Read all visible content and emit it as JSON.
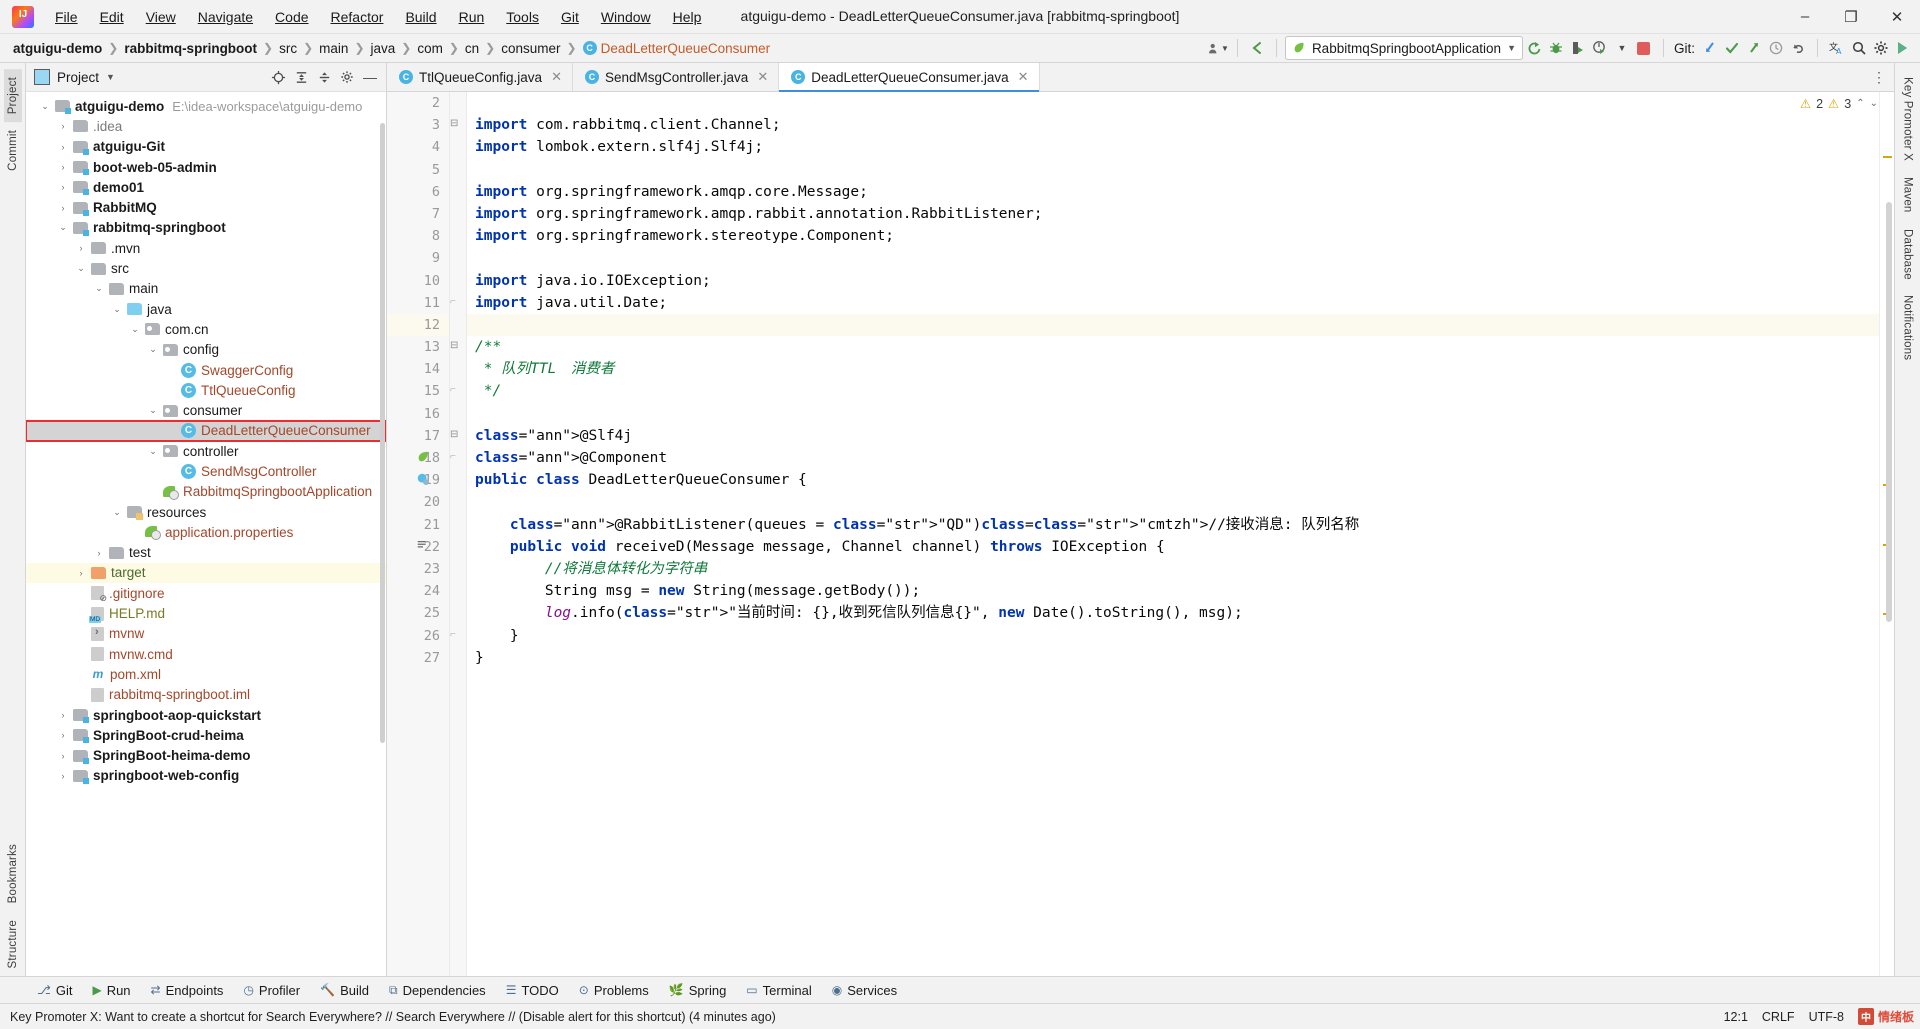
{
  "window": {
    "title": "atguigu-demo - DeadLetterQueueConsumer.java [rabbitmq-springboot]",
    "minimize": "–",
    "maximize": "❐",
    "close": "✕"
  },
  "menubar": [
    {
      "label": "File"
    },
    {
      "label": "Edit"
    },
    {
      "label": "View"
    },
    {
      "label": "Navigate"
    },
    {
      "label": "Code"
    },
    {
      "label": "Refactor"
    },
    {
      "label": "Build"
    },
    {
      "label": "Run"
    },
    {
      "label": "Tools"
    },
    {
      "label": "Git"
    },
    {
      "label": "Window"
    },
    {
      "label": "Help"
    }
  ],
  "breadcrumbs": [
    {
      "label": "atguigu-demo",
      "bold": true
    },
    {
      "label": "rabbitmq-springboot",
      "bold": true
    },
    {
      "label": "src",
      "bold": false
    },
    {
      "label": "main",
      "bold": false
    },
    {
      "label": "java",
      "bold": false
    },
    {
      "label": "com",
      "bold": false
    },
    {
      "label": "cn",
      "bold": false
    },
    {
      "label": "consumer",
      "bold": false
    },
    {
      "label": "DeadLetterQueueConsumer",
      "bold": false,
      "file": true
    }
  ],
  "toolbar": {
    "run_config": "RabbitmqSpringbootApplication",
    "run_config_caret": "▼",
    "git_label": "Git:",
    "icons": {
      "user_avatar": "user-avatar-icon",
      "back_arrow": "back-arrow-icon",
      "rerun": "rerun-icon",
      "debug": "debug-bug-icon",
      "run_with_coverage": "run-coverage-icon",
      "profiler": "profiler-icon",
      "stop": "stop-icon",
      "update_project": "update-project-icon",
      "commit": "commit-check-icon",
      "push": "push-arrow-icon",
      "history": "history-clock-icon",
      "rollback": "rollback-icon",
      "translate": "translate-icon",
      "search_everywhere": "search-icon",
      "settings": "gear-icon",
      "run_anything": "run-anything-icon"
    }
  },
  "left_rail": [
    {
      "label": "Project",
      "active": true
    },
    {
      "label": "Commit",
      "active": false
    },
    {
      "label": "Bookmarks",
      "active": false
    },
    {
      "label": "Structure",
      "active": false
    }
  ],
  "right_rail": [
    {
      "label": "Key Promoter X"
    },
    {
      "label": "Maven"
    },
    {
      "label": "Database"
    },
    {
      "label": "Notifications"
    }
  ],
  "project_panel": {
    "title": "Project",
    "caret": "▼",
    "header_icons": [
      "target-scroll-from-source-icon",
      "expand-all-icon",
      "collapse-all-icon",
      "gear-icon",
      "hide-icon"
    ],
    "tree": [
      {
        "depth": 0,
        "arrow": "v",
        "icon": "module",
        "label": "atguigu-demo",
        "bold": true,
        "path": "E:\\idea-workspace\\atguigu-demo"
      },
      {
        "depth": 1,
        "arrow": ">",
        "icon": "folder",
        "label": ".idea",
        "bold": false,
        "gray": true
      },
      {
        "depth": 1,
        "arrow": ">",
        "icon": "module",
        "label": "atguigu-Git",
        "bold": true
      },
      {
        "depth": 1,
        "arrow": ">",
        "icon": "module",
        "label": "boot-web-05-admin",
        "bold": true
      },
      {
        "depth": 1,
        "arrow": ">",
        "icon": "module",
        "label": "demo01",
        "bold": true
      },
      {
        "depth": 1,
        "arrow": ">",
        "icon": "module",
        "label": "RabbitMQ",
        "bold": true
      },
      {
        "depth": 1,
        "arrow": "v",
        "icon": "module",
        "label": "rabbitmq-springboot",
        "bold": true
      },
      {
        "depth": 2,
        "arrow": ">",
        "icon": "folder",
        "label": ".mvn",
        "bold": false
      },
      {
        "depth": 2,
        "arrow": "v",
        "icon": "folder",
        "label": "src",
        "bold": false
      },
      {
        "depth": 3,
        "arrow": "v",
        "icon": "folder",
        "label": "main",
        "bold": false
      },
      {
        "depth": 4,
        "arrow": "v",
        "icon": "source",
        "label": "java",
        "bold": false
      },
      {
        "depth": 5,
        "arrow": "v",
        "icon": "package",
        "label": "com.cn",
        "bold": false
      },
      {
        "depth": 6,
        "arrow": "v",
        "icon": "package",
        "label": "config",
        "bold": false
      },
      {
        "depth": 7,
        "arrow": "none",
        "icon": "class",
        "label": "SwaggerConfig",
        "bold": false,
        "java": true
      },
      {
        "depth": 7,
        "arrow": "none",
        "icon": "class",
        "label": "TtlQueueConfig",
        "bold": false,
        "java": true
      },
      {
        "depth": 6,
        "arrow": "v",
        "icon": "package",
        "label": "consumer",
        "bold": false
      },
      {
        "depth": 7,
        "arrow": "none",
        "icon": "class",
        "label": "DeadLetterQueueConsumer",
        "bold": false,
        "java": true,
        "selected": true,
        "highlight_box": true
      },
      {
        "depth": 6,
        "arrow": "v",
        "icon": "package",
        "label": "controller",
        "bold": false
      },
      {
        "depth": 7,
        "arrow": "none",
        "icon": "class",
        "label": "SendMsgController",
        "bold": false,
        "java": true
      },
      {
        "depth": 6,
        "arrow": "none",
        "icon": "spring-class",
        "label": "RabbitmqSpringbootApplication",
        "bold": false,
        "java": true
      },
      {
        "depth": 4,
        "arrow": "v",
        "icon": "resources",
        "label": "resources",
        "bold": false
      },
      {
        "depth": 5,
        "arrow": "none",
        "icon": "spring-file",
        "label": "application.properties",
        "bold": false,
        "java": true
      },
      {
        "depth": 3,
        "arrow": ">",
        "icon": "folder",
        "label": "test",
        "bold": false
      },
      {
        "depth": 2,
        "arrow": ">",
        "icon": "target",
        "label": "target",
        "bold": false,
        "yellow": true,
        "greenish": true
      },
      {
        "depth": 2,
        "arrow": "none",
        "icon": "gitignore",
        "label": ".gitignore",
        "bold": false,
        "java": true
      },
      {
        "depth": 2,
        "arrow": "none",
        "icon": "md",
        "label": "HELP.md",
        "bold": false,
        "olive": true
      },
      {
        "depth": 2,
        "arrow": "none",
        "icon": "sh",
        "label": "mvnw",
        "bold": false,
        "java": true
      },
      {
        "depth": 2,
        "arrow": "none",
        "icon": "txt",
        "label": "mvnw.cmd",
        "bold": false,
        "java": true
      },
      {
        "depth": 2,
        "arrow": "none",
        "icon": "maven",
        "label": "pom.xml",
        "bold": false,
        "java": true
      },
      {
        "depth": 2,
        "arrow": "none",
        "icon": "txt",
        "label": "rabbitmq-springboot.iml",
        "bold": false,
        "java": true
      },
      {
        "depth": 1,
        "arrow": ">",
        "icon": "module",
        "label": "springboot-aop-quickstart",
        "bold": true
      },
      {
        "depth": 1,
        "arrow": ">",
        "icon": "module",
        "label": "SpringBoot-crud-heima",
        "bold": true
      },
      {
        "depth": 1,
        "arrow": ">",
        "icon": "module",
        "label": "SpringBoot-heima-demo",
        "bold": true
      },
      {
        "depth": 1,
        "arrow": ">",
        "icon": "module",
        "label": "springboot-web-config",
        "bold": true
      }
    ]
  },
  "editor_tabs": [
    {
      "label": "TtlQueueConfig.java",
      "active": false,
      "close": "✕"
    },
    {
      "label": "SendMsgController.java",
      "active": false,
      "close": "✕"
    },
    {
      "label": "DeadLetterQueueConsumer.java",
      "active": true,
      "close": "✕"
    }
  ],
  "inspection": {
    "warning_icon": "warning-triangle-icon",
    "warning_count": "2",
    "weak_warning_icon": "weak-warning-icon",
    "weak_warning_count": "3",
    "chevron_up": "⌃",
    "chevron_down": "⌄"
  },
  "code": {
    "first_line_number": 2,
    "lines": [
      {
        "n": 2,
        "text": "",
        "cur": false
      },
      {
        "n": 3,
        "text": "import com.rabbitmq.client.Channel;",
        "cur": false,
        "fold": "minus"
      },
      {
        "n": 4,
        "text": "import lombok.extern.slf4j.Slf4j;",
        "cur": false
      },
      {
        "n": 5,
        "text": "",
        "cur": false
      },
      {
        "n": 6,
        "text": "import org.springframework.amqp.core.Message;",
        "cur": false
      },
      {
        "n": 7,
        "text": "import org.springframework.amqp.rabbit.annotation.RabbitListener;",
        "cur": false
      },
      {
        "n": 8,
        "text": "import org.springframework.stereotype.Component;",
        "cur": false
      },
      {
        "n": 9,
        "text": "",
        "cur": false
      },
      {
        "n": 10,
        "text": "import java.io.IOException;",
        "cur": false
      },
      {
        "n": 11,
        "text": "import java.util.Date;",
        "cur": false,
        "fold": "end"
      },
      {
        "n": 12,
        "text": "",
        "cur": true
      },
      {
        "n": 13,
        "text": "/**",
        "cur": false,
        "fold": "minus"
      },
      {
        "n": 14,
        "text": " * 队列TTL　消费者",
        "cur": false
      },
      {
        "n": 15,
        "text": " */",
        "cur": false,
        "fold": "end"
      },
      {
        "n": 16,
        "text": "",
        "cur": false
      },
      {
        "n": 17,
        "text": "@Slf4j",
        "cur": false,
        "fold": "minus"
      },
      {
        "n": 18,
        "text": "@Component",
        "cur": false,
        "fold": "end",
        "gutter": "spring-bean-icon"
      },
      {
        "n": 19,
        "text": "public class DeadLetterQueueConsumer {",
        "cur": false,
        "gutter": "spring-class-icon"
      },
      {
        "n": 20,
        "text": "",
        "cur": false
      },
      {
        "n": 21,
        "text": "    @RabbitListener(queues = \"QD\")//接收消息: 队列名称",
        "cur": false
      },
      {
        "n": 22,
        "text": "    public void receiveD(Message message, Channel channel) throws IOException {",
        "cur": false,
        "gutter": "override-impl-icon"
      },
      {
        "n": 23,
        "text": "        //将消息体转化为字符串",
        "cur": false
      },
      {
        "n": 24,
        "text": "        String msg = new String(message.getBody());",
        "cur": false
      },
      {
        "n": 25,
        "text": "        log.info(\"当前时间: {},收到死信队列信息{}\", new Date().toString(), msg);",
        "cur": false
      },
      {
        "n": 26,
        "text": "    }",
        "cur": false,
        "fold": "end"
      },
      {
        "n": 27,
        "text": "}",
        "cur": false
      }
    ]
  },
  "tool_windows": [
    {
      "label": "Git",
      "icon": "git-icon"
    },
    {
      "label": "Run",
      "icon": "run-icon"
    },
    {
      "label": "Endpoints",
      "icon": "endpoints-icon"
    },
    {
      "label": "Profiler",
      "icon": "profiler-icon"
    },
    {
      "label": "Build",
      "icon": "build-icon"
    },
    {
      "label": "Dependencies",
      "icon": "dependencies-icon"
    },
    {
      "label": "TODO",
      "icon": "todo-icon"
    },
    {
      "label": "Problems",
      "icon": "problems-icon"
    },
    {
      "label": "Spring",
      "icon": "spring-icon"
    },
    {
      "label": "Terminal",
      "icon": "terminal-icon"
    },
    {
      "label": "Services",
      "icon": "services-icon"
    }
  ],
  "statusbar": {
    "message": "Key Promoter X: Want to create a shortcut for Search Everywhere? // Search Everywhere // (Disable alert for this shortcut) (4 minutes ago)",
    "caret": "12:1",
    "line_sep": "CRLF",
    "encoding": "UTF-8",
    "watermark_badge": "中",
    "watermark_text": "情绪板"
  },
  "colors": {
    "accent": "#3c8ee0",
    "selection": "#d4d4d4",
    "highlight_box": "#ec2d2d",
    "keyword": "#0033b3",
    "string": "#067d17",
    "comment": "#0f7a39",
    "annotation": "#9e880d",
    "current_line": "#fcfaef",
    "spring_green": "#76c043",
    "stop_red": "#e05b5b"
  }
}
